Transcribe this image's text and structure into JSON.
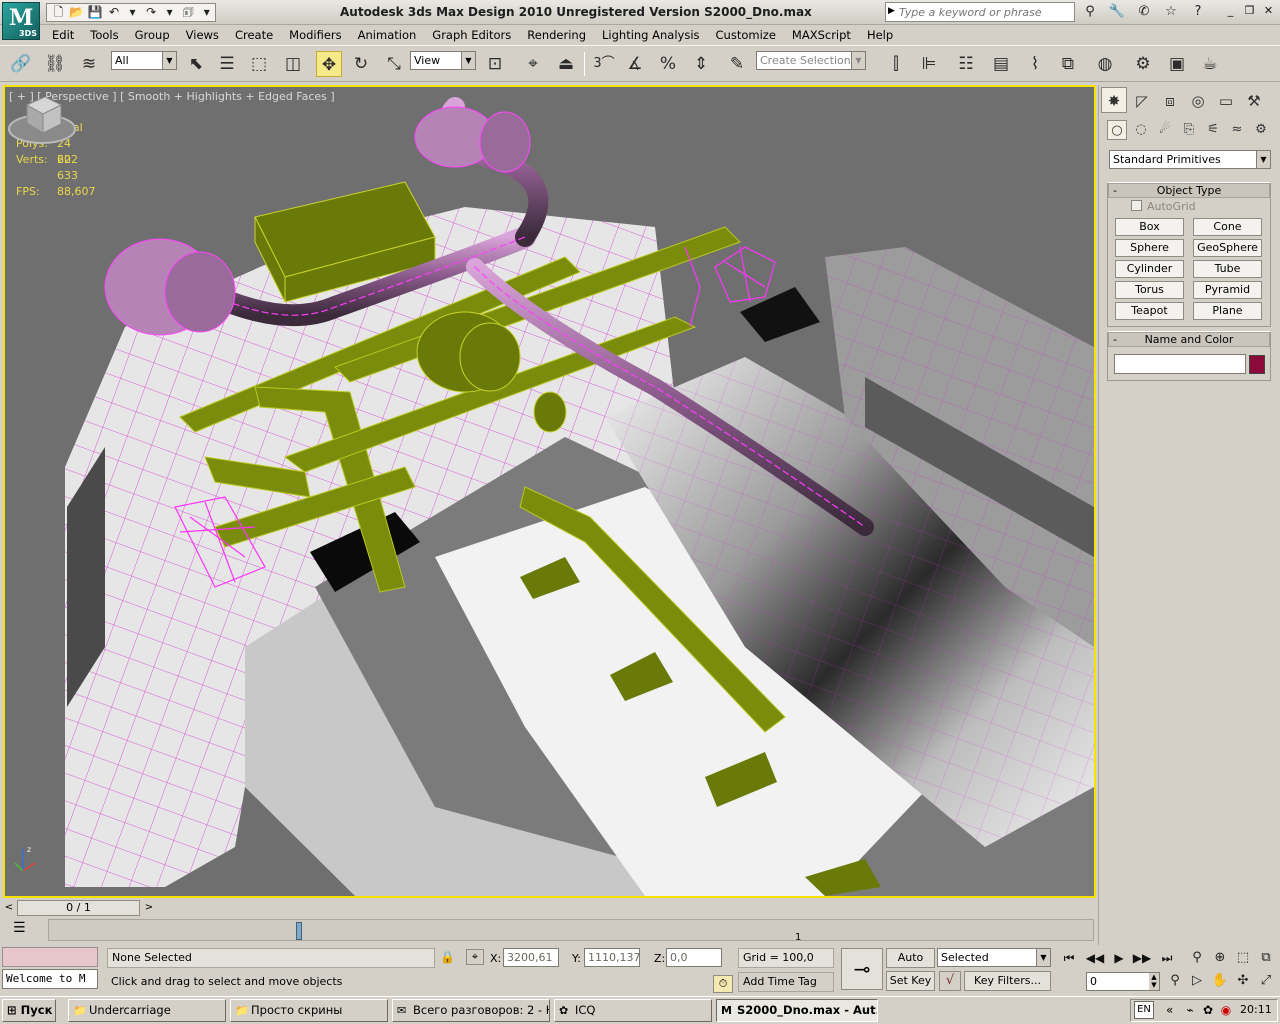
{
  "app": {
    "logo_text": "3DS",
    "window_title": "Autodesk 3ds Max Design 2010    Unregistered Version    S2000_Dno.max"
  },
  "search": {
    "placeholder": "Type a keyword or phrase"
  },
  "menu": [
    "Edit",
    "Tools",
    "Group",
    "Views",
    "Create",
    "Modifiers",
    "Animation",
    "Graph Editors",
    "Rendering",
    "Lighting Analysis",
    "Customize",
    "MAXScript",
    "Help"
  ],
  "toolbar": {
    "selection_filter": "All",
    "reference_coord": "View",
    "snap_angle_label": "3",
    "selection_set_placeholder": "Create Selection Se"
  },
  "viewport": {
    "label": "[ + ] [ Perspective ] [ Smooth + Highlights + Edged Faces ]",
    "stats": {
      "header": "Total",
      "polys_label": "Polys:",
      "polys": "24 602",
      "verts_label": "Verts:",
      "verts": "22 633",
      "fps_label": "FPS:",
      "fps": "88,607"
    },
    "axis_label": "z"
  },
  "command_panel": {
    "category": "Standard Primitives",
    "object_type_title": "Object Type",
    "autogrid_label": "AutoGrid",
    "primitives": [
      "Box",
      "Cone",
      "Sphere",
      "GeoSphere",
      "Cylinder",
      "Tube",
      "Torus",
      "Pyramid",
      "Teapot",
      "Plane"
    ],
    "name_color_title": "Name and Color",
    "object_name": "",
    "object_color": "#8b0a3a"
  },
  "timeslider": {
    "position_text": "0 / 1",
    "tick_label": "1"
  },
  "status": {
    "listener_text": "Welcome to M",
    "selection": "None Selected",
    "prompt": "Click and drag to select and move objects",
    "x_label": "X:",
    "x": "3200,61",
    "y_label": "Y:",
    "y": "1110,137",
    "z_label": "Z:",
    "z": "0,0",
    "grid": "Grid = 100,0",
    "add_time_tag": "Add Time Tag",
    "auto_key": "Auto Key",
    "set_key": "Set Key",
    "key_mode": "Selected",
    "key_filters": "Key Filters...",
    "frame": "0"
  },
  "taskbar": {
    "start": "Пуск",
    "tasks": [
      "Undercarriage",
      "Просто скрины",
      "Всего разговоров: 2 - Н...",
      "ICQ",
      "S2000_Dno.max - Aut..."
    ],
    "language": "EN",
    "clock": "20:11"
  }
}
